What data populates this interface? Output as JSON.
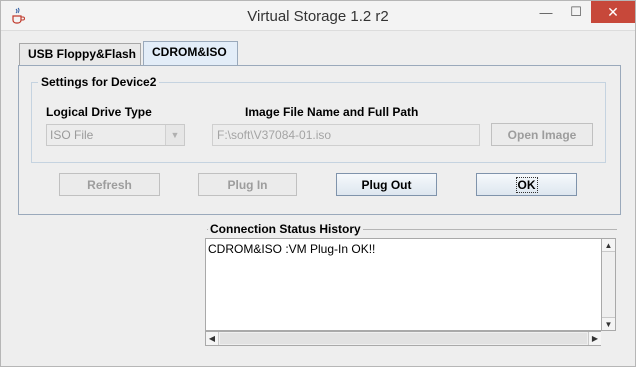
{
  "window": {
    "title": "Virtual Storage 1.2 r2",
    "icon": "java-cup-icon",
    "controls": {
      "minimize": "—",
      "maximize": "☐",
      "close": "✕"
    }
  },
  "tabs": [
    {
      "label": "USB Floppy&Flash",
      "selected": false
    },
    {
      "label": "CDROM&ISO",
      "selected": true
    }
  ],
  "settings": {
    "group_title": "Settings for Device2",
    "drive_type_label": "Logical Drive Type",
    "drive_type_value": "ISO File",
    "path_label": "Image File Name and Full Path",
    "path_value": "F:\\soft\\V37084-01.iso",
    "open_image_label": "Open Image"
  },
  "actions": {
    "refresh": "Refresh",
    "plug_in": "Plug In",
    "plug_out": "Plug Out",
    "ok": "OK"
  },
  "status": {
    "title": "Connection Status History",
    "log": "CDROM&ISO :VM Plug-In OK!!"
  }
}
